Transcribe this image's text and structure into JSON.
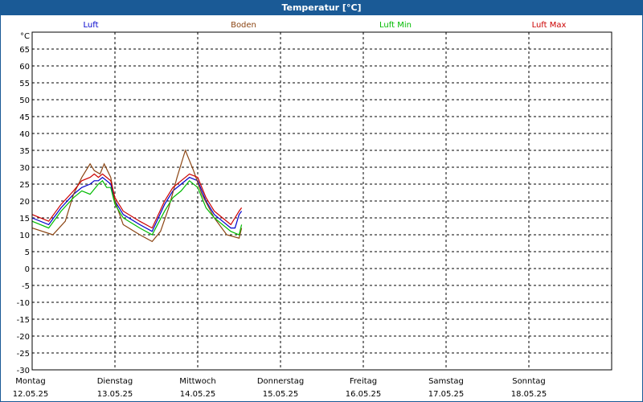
{
  "window": {
    "title": "Temperatur [°C]"
  },
  "colors": {
    "titlebar": "#1a5a96",
    "Luft": "#0000cc",
    "Boden": "#8b4513",
    "Luft Min": "#00bb00",
    "Luft Max": "#cc0000"
  },
  "chart_data": {
    "type": "line",
    "title": "Temperatur [°C]",
    "ylabel": "°C",
    "ylim": [
      -30,
      70
    ],
    "yticks": [
      65,
      60,
      55,
      50,
      45,
      40,
      35,
      30,
      25,
      20,
      15,
      10,
      5,
      0,
      -5,
      -10,
      -15,
      -20,
      -25,
      -30
    ],
    "grid": true,
    "legend_position": "top",
    "days": [
      {
        "name": "Montag",
        "date": "12.05.25"
      },
      {
        "name": "Dienstag",
        "date": "13.05.25"
      },
      {
        "name": "Mittwoch",
        "date": "14.05.25"
      },
      {
        "name": "Donnerstag",
        "date": "15.05.25"
      },
      {
        "name": "Freitag",
        "date": "16.05.25"
      },
      {
        "name": "Samstag",
        "date": "17.05.25"
      },
      {
        "name": "Sonntag",
        "date": "18.05.25"
      }
    ],
    "x_unit": "days since 12.05.25 00:00",
    "series": [
      {
        "name": "Luft",
        "color": "#0000cc",
        "points": [
          [
            0,
            15
          ],
          [
            0.2,
            13
          ],
          [
            0.35,
            18
          ],
          [
            0.5,
            22
          ],
          [
            0.6,
            24
          ],
          [
            0.7,
            25
          ],
          [
            0.75,
            26
          ],
          [
            0.8,
            26
          ],
          [
            0.85,
            27
          ],
          [
            0.9,
            26
          ],
          [
            0.95,
            25
          ],
          [
            1.0,
            20
          ],
          [
            1.1,
            16
          ],
          [
            1.3,
            13
          ],
          [
            1.45,
            11
          ],
          [
            1.6,
            19
          ],
          [
            1.7,
            23
          ],
          [
            1.8,
            25
          ],
          [
            1.9,
            27
          ],
          [
            2.0,
            26
          ],
          [
            2.1,
            20
          ],
          [
            2.2,
            16
          ],
          [
            2.3,
            14
          ],
          [
            2.4,
            12
          ],
          [
            2.45,
            12
          ],
          [
            2.5,
            16
          ],
          [
            2.53,
            17
          ]
        ]
      },
      {
        "name": "Boden",
        "color": "#8b4513",
        "points": [
          [
            0,
            12
          ],
          [
            0.25,
            10
          ],
          [
            0.4,
            14
          ],
          [
            0.5,
            22
          ],
          [
            0.6,
            27
          ],
          [
            0.7,
            31
          ],
          [
            0.75,
            29
          ],
          [
            0.82,
            28
          ],
          [
            0.87,
            31
          ],
          [
            0.95,
            27
          ],
          [
            1.0,
            20
          ],
          [
            1.1,
            13
          ],
          [
            1.3,
            10
          ],
          [
            1.45,
            8
          ],
          [
            1.55,
            11
          ],
          [
            1.65,
            18
          ],
          [
            1.75,
            27
          ],
          [
            1.85,
            35
          ],
          [
            1.95,
            29
          ],
          [
            2.05,
            22
          ],
          [
            2.2,
            15
          ],
          [
            2.35,
            10
          ],
          [
            2.5,
            9
          ],
          [
            2.53,
            12
          ]
        ]
      },
      {
        "name": "Luft Min",
        "color": "#00bb00",
        "points": [
          [
            0,
            14
          ],
          [
            0.2,
            12
          ],
          [
            0.35,
            17
          ],
          [
            0.5,
            21
          ],
          [
            0.6,
            23
          ],
          [
            0.7,
            22
          ],
          [
            0.8,
            25
          ],
          [
            0.85,
            26
          ],
          [
            0.9,
            24
          ],
          [
            0.95,
            24
          ],
          [
            1.0,
            19
          ],
          [
            1.1,
            15
          ],
          [
            1.3,
            12
          ],
          [
            1.45,
            10
          ],
          [
            1.6,
            17
          ],
          [
            1.7,
            21
          ],
          [
            1.8,
            23
          ],
          [
            1.9,
            26
          ],
          [
            2.0,
            24
          ],
          [
            2.1,
            18
          ],
          [
            2.2,
            15
          ],
          [
            2.3,
            13
          ],
          [
            2.4,
            11
          ],
          [
            2.5,
            10
          ],
          [
            2.53,
            13
          ]
        ]
      },
      {
        "name": "Luft Max",
        "color": "#cc0000",
        "points": [
          [
            0,
            16
          ],
          [
            0.2,
            14
          ],
          [
            0.35,
            19
          ],
          [
            0.5,
            23
          ],
          [
            0.6,
            26
          ],
          [
            0.7,
            27
          ],
          [
            0.75,
            28
          ],
          [
            0.8,
            27
          ],
          [
            0.85,
            28
          ],
          [
            0.9,
            27
          ],
          [
            0.95,
            26
          ],
          [
            1.0,
            21
          ],
          [
            1.1,
            17
          ],
          [
            1.3,
            14
          ],
          [
            1.45,
            12
          ],
          [
            1.6,
            20
          ],
          [
            1.7,
            24
          ],
          [
            1.8,
            26
          ],
          [
            1.9,
            28
          ],
          [
            2.0,
            27
          ],
          [
            2.1,
            21
          ],
          [
            2.2,
            17
          ],
          [
            2.3,
            15
          ],
          [
            2.4,
            13
          ],
          [
            2.5,
            17
          ],
          [
            2.53,
            18
          ]
        ]
      }
    ]
  }
}
